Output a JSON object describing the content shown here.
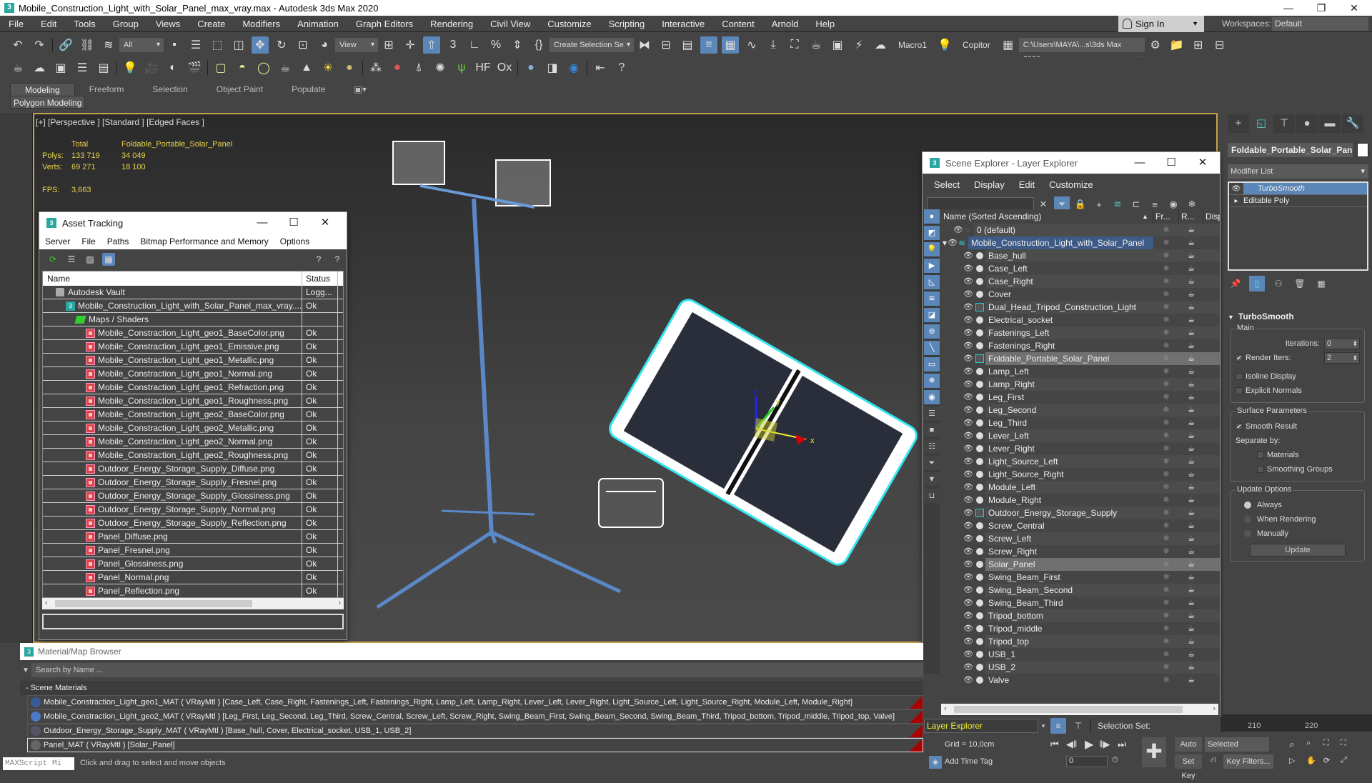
{
  "window": {
    "title": "Mobile_Construction_Light_with_Solar_Panel_max_vray.max - Autodesk 3ds Max 2020",
    "app_icon": "3",
    "controls": {
      "minimize": "—",
      "restore": "❐",
      "close": "✕"
    }
  },
  "menubar": {
    "items": [
      "File",
      "Edit",
      "Tools",
      "Group",
      "Views",
      "Create",
      "Modifiers",
      "Animation",
      "Graph Editors",
      "Rendering",
      "Civil View",
      "Customize",
      "Scripting",
      "Interactive",
      "Content",
      "Arnold",
      "Help"
    ],
    "sign_in": "Sign In",
    "workspaces_label": "Workspaces:",
    "workspace_value": "Default"
  },
  "toolbar_main": {
    "selection_filter": "All",
    "ref_coord": "View",
    "named_selection": "Create Selection Se",
    "macro_label": "Macro1",
    "copitor_label": "Copitor",
    "project_path": "C:\\Users\\MAYA\\...s\\3ds Max 2020"
  },
  "ribbon": {
    "tabs": [
      "Modeling",
      "Freeform",
      "Selection",
      "Object Paint",
      "Populate"
    ],
    "active_tab": "Modeling",
    "panel": "Polygon Modeling"
  },
  "viewport": {
    "label": "[+] [Perspective ] [Standard ] [Edged Faces ]",
    "stats": {
      "col_total": "Total",
      "col_object": "Foldable_Portable_Solar_Panel",
      "polys_label": "Polys:",
      "polys_total": "133 719",
      "polys_object": "34 049",
      "verts_label": "Verts:",
      "verts_total": "69 271",
      "verts_object": "18 100",
      "fps_label": "FPS:",
      "fps_value": "3,663"
    },
    "gizmo_axes": {
      "x": "x",
      "y": "y",
      "z": "z"
    }
  },
  "asset_tracking": {
    "title": "Asset Tracking",
    "menu": [
      "Server",
      "File",
      "Paths",
      "Bitmap Performance and Memory",
      "Options"
    ],
    "columns": [
      "Name",
      "Status"
    ],
    "rows": [
      {
        "name": "Autodesk Vault",
        "status": "Logg...",
        "level": 1,
        "icon": "vault-icon"
      },
      {
        "name": "Mobile_Construction_Light_with_Solar_Panel_max_vray....",
        "status": "Ok",
        "level": 2,
        "icon": "max-file-icon"
      },
      {
        "name": "Maps / Shaders",
        "status": "",
        "level": 3,
        "icon": "maps-icon"
      },
      {
        "name": "Mobile_Constraction_Light_geo1_BaseColor.png",
        "status": "Ok",
        "level": 4,
        "icon": "bitmap-icon"
      },
      {
        "name": "Mobile_Constraction_Light_geo1_Emissive.png",
        "status": "Ok",
        "level": 4,
        "icon": "bitmap-icon"
      },
      {
        "name": "Mobile_Constraction_Light_geo1_Metallic.png",
        "status": "Ok",
        "level": 4,
        "icon": "bitmap-icon"
      },
      {
        "name": "Mobile_Constraction_Light_geo1_Normal.png",
        "status": "Ok",
        "level": 4,
        "icon": "bitmap-icon"
      },
      {
        "name": "Mobile_Constraction_Light_geo1_Refraction.png",
        "status": "Ok",
        "level": 4,
        "icon": "bitmap-icon"
      },
      {
        "name": "Mobile_Constraction_Light_geo1_Roughness.png",
        "status": "Ok",
        "level": 4,
        "icon": "bitmap-icon"
      },
      {
        "name": "Mobile_Constraction_Light_geo2_BaseColor.png",
        "status": "Ok",
        "level": 4,
        "icon": "bitmap-icon"
      },
      {
        "name": "Mobile_Constraction_Light_geo2_Metallic.png",
        "status": "Ok",
        "level": 4,
        "icon": "bitmap-icon"
      },
      {
        "name": "Mobile_Constraction_Light_geo2_Normal.png",
        "status": "Ok",
        "level": 4,
        "icon": "bitmap-icon"
      },
      {
        "name": "Mobile_Constraction_Light_geo2_Roughness.png",
        "status": "Ok",
        "level": 4,
        "icon": "bitmap-icon"
      },
      {
        "name": "Outdoor_Energy_Storage_Supply_Diffuse.png",
        "status": "Ok",
        "level": 4,
        "icon": "bitmap-icon"
      },
      {
        "name": "Outdoor_Energy_Storage_Supply_Fresnel.png",
        "status": "Ok",
        "level": 4,
        "icon": "bitmap-icon"
      },
      {
        "name": "Outdoor_Energy_Storage_Supply_Glossiness.png",
        "status": "Ok",
        "level": 4,
        "icon": "bitmap-icon"
      },
      {
        "name": "Outdoor_Energy_Storage_Supply_Normal.png",
        "status": "Ok",
        "level": 4,
        "icon": "bitmap-icon"
      },
      {
        "name": "Outdoor_Energy_Storage_Supply_Reflection.png",
        "status": "Ok",
        "level": 4,
        "icon": "bitmap-icon"
      },
      {
        "name": "Panel_Diffuse.png",
        "status": "Ok",
        "level": 4,
        "icon": "bitmap-icon"
      },
      {
        "name": "Panel_Fresnel.png",
        "status": "Ok",
        "level": 4,
        "icon": "bitmap-icon"
      },
      {
        "name": "Panel_Glossiness.png",
        "status": "Ok",
        "level": 4,
        "icon": "bitmap-icon"
      },
      {
        "name": "Panel_Normal.png",
        "status": "Ok",
        "level": 4,
        "icon": "bitmap-icon"
      },
      {
        "name": "Panel_Reflection.png",
        "status": "Ok",
        "level": 4,
        "icon": "bitmap-icon"
      }
    ]
  },
  "scene_explorer": {
    "title": "Scene Explorer - Layer Explorer",
    "menu": [
      "Select",
      "Display",
      "Edit",
      "Customize"
    ],
    "columns": {
      "name": "Name (Sorted Ascending)",
      "frozen": "Fr...",
      "render": "R...",
      "display": "Disp"
    },
    "layers": [
      {
        "name": "0 (default)",
        "type": "layer-default"
      },
      {
        "name": "Mobile_Construction_Light_with_Solar_Panel",
        "type": "layer-active"
      }
    ],
    "objects": [
      {
        "name": "Base_hull",
        "group": false,
        "selected": false
      },
      {
        "name": "Case_Left",
        "group": false,
        "selected": false
      },
      {
        "name": "Case_Right",
        "group": false,
        "selected": false
      },
      {
        "name": "Cover",
        "group": false,
        "selected": false
      },
      {
        "name": "Dual_Head_Tripod_Construction_Light",
        "group": true,
        "selected": false
      },
      {
        "name": "Electrical_socket",
        "group": false,
        "selected": false
      },
      {
        "name": "Fastenings_Left",
        "group": false,
        "selected": false
      },
      {
        "name": "Fastenings_Right",
        "group": false,
        "selected": false
      },
      {
        "name": "Foldable_Portable_Solar_Panel",
        "group": true,
        "selected": true
      },
      {
        "name": "Lamp_Left",
        "group": false,
        "selected": false
      },
      {
        "name": "Lamp_Right",
        "group": false,
        "selected": false
      },
      {
        "name": "Leg_First",
        "group": false,
        "selected": false
      },
      {
        "name": "Leg_Second",
        "group": false,
        "selected": false
      },
      {
        "name": "Leg_Third",
        "group": false,
        "selected": false
      },
      {
        "name": "Lever_Left",
        "group": false,
        "selected": false
      },
      {
        "name": "Lever_Right",
        "group": false,
        "selected": false
      },
      {
        "name": "Light_Source_Left",
        "group": false,
        "selected": false
      },
      {
        "name": "Light_Source_Right",
        "group": false,
        "selected": false
      },
      {
        "name": "Module_Left",
        "group": false,
        "selected": false
      },
      {
        "name": "Module_Right",
        "group": false,
        "selected": false
      },
      {
        "name": "Outdoor_Energy_Storage_Supply",
        "group": true,
        "selected": false
      },
      {
        "name": "Screw_Central",
        "group": false,
        "selected": false
      },
      {
        "name": "Screw_Left",
        "group": false,
        "selected": false
      },
      {
        "name": "Screw_Right",
        "group": false,
        "selected": false
      },
      {
        "name": "Solar_Panel",
        "group": false,
        "selected": true
      },
      {
        "name": "Swing_Beam_First",
        "group": false,
        "selected": false
      },
      {
        "name": "Swing_Beam_Second",
        "group": false,
        "selected": false
      },
      {
        "name": "Swing_Beam_Third",
        "group": false,
        "selected": false
      },
      {
        "name": "Tripod_bottom",
        "group": false,
        "selected": false
      },
      {
        "name": "Tripod_middle",
        "group": false,
        "selected": false
      },
      {
        "name": "Tripod_top",
        "group": false,
        "selected": false
      },
      {
        "name": "USB_1",
        "group": false,
        "selected": false
      },
      {
        "name": "USB_2",
        "group": false,
        "selected": false
      },
      {
        "name": "Valve",
        "group": false,
        "selected": false
      }
    ],
    "explorer_type": "Layer Explorer",
    "selection_set_label": "Selection Set:"
  },
  "command_panel": {
    "object_name": "Foldable_Portable_Solar_Panel",
    "modifier_list": "Modifier List",
    "stack": [
      {
        "name": "TurboSmooth",
        "selected": true
      },
      {
        "name": "Editable Poly",
        "selected": false
      }
    ],
    "turbosmooth": {
      "title": "TurboSmooth",
      "main_group": "Main",
      "iterations_label": "Iterations:",
      "iterations_value": "0",
      "render_iters_label": "Render Iters:",
      "render_iters_value": "2",
      "render_iters_checked": true,
      "isoline_label": "Isoline Display",
      "isoline_checked": false,
      "explicit_normals_label": "Explicit Normals",
      "explicit_normals_checked": false,
      "surface_group": "Surface Parameters",
      "smooth_result_label": "Smooth Result",
      "smooth_result_checked": true,
      "separate_by_label": "Separate by:",
      "materials_label": "Materials",
      "smoothing_groups_label": "Smoothing Groups",
      "update_group": "Update Options",
      "update_options": [
        "Always",
        "When Rendering",
        "Manually"
      ],
      "update_selected": "Always",
      "update_button": "Update"
    }
  },
  "material_browser": {
    "title": "Material/Map Browser",
    "search_placeholder": "Search by Name ...",
    "section": "- Scene Materials",
    "materials": [
      {
        "text": "Mobile_Constraction_Light_geo1_MAT ( VRayMtl ) [Case_Left, Case_Right, Fastenings_Left, Fastenings_Right, Lamp_Left, Lamp_Right, Lever_Left, Lever_Right, Light_Source_Left, Light_Source_Right, Module_Left, Module_Right]",
        "swatch": "#3a5a9a"
      },
      {
        "text": "Mobile_Constraction_Light_geo2_MAT ( VRayMtl ) [Leg_First, Leg_Second, Leg_Third, Screw_Central, Screw_Left, Screw_Right, Swing_Beam_First, Swing_Beam_Second, Swing_Beam_Third, Tripod_bottom, Tripod_middle, Tripod_top, Valve]",
        "swatch": "#4a7ac8"
      },
      {
        "text": "Outdoor_Energy_Storage_Supply_MAT ( VRayMtl ) [Base_hull, Cover, Electrical_socket, USB_1, USB_2]",
        "swatch": "#556"
      },
      {
        "text": "Panel_MAT ( VRayMtl ) [Solar_Panel]",
        "swatch": "#666"
      }
    ]
  },
  "status": {
    "maxscript_label": "MAXScript Mi",
    "prompt": "Click and drag to select and move objects",
    "grid": "Grid = 10,0cm",
    "add_time_tag": "Add Time Tag",
    "frame_value": "0",
    "auto_key": "Auto Key",
    "set_key": "Set Key",
    "key_mode": "Selected",
    "key_filters": "Key Filters...",
    "timeline_ticks": [
      "210",
      "220"
    ]
  },
  "colors": {
    "accent": "#5b86b8",
    "viewport_border": "#c8a24a",
    "stats_text": "#e8d24a",
    "selection_cyan": "#33e6f0"
  }
}
